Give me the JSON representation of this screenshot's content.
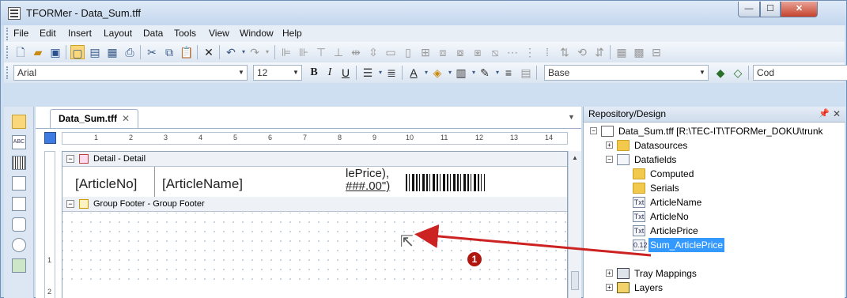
{
  "window": {
    "title": "TFORMer - Data_Sum.tff"
  },
  "menu": [
    "File",
    "Edit",
    "Insert",
    "Layout",
    "Data",
    "Tools",
    "View",
    "Window",
    "Help"
  ],
  "format_toolbar": {
    "font": "Arial",
    "size": "12",
    "style": "Base",
    "code_label": "Cod"
  },
  "document": {
    "tab_label": "Data_Sum.tff",
    "ruler_numbers": [
      "1",
      "2",
      "3",
      "4",
      "5",
      "6",
      "7",
      "8",
      "9",
      "10",
      "11",
      "12",
      "13",
      "14"
    ],
    "vruler_numbers": [
      "1",
      "2"
    ],
    "detail_band": "Detail - Detail",
    "footer_band": "Group Footer - Group Footer",
    "fields": {
      "article_no": "[ArticleNo]",
      "article_name": "[ArticleName]",
      "price_line1": "lePrice),",
      "price_line2": "###.00\")"
    }
  },
  "marker": "1",
  "repository": {
    "title": "Repository/Design",
    "root": "Data_Sum.tff [R:\\TEC-IT\\TFORMer_DOKU\\trunk",
    "datasources": "Datasources",
    "datafields": "Datafields",
    "computed": "Computed",
    "serials": "Serials",
    "article_name": "ArticleName",
    "article_no": "ArticleNo",
    "article_price": "ArticlePrice",
    "sum_article_price": "Sum_ArticlePrice",
    "tray_mappings": "Tray Mappings",
    "layers": "Layers",
    "txt_icon": "Txt",
    "num_icon": "0.12"
  },
  "colors": {
    "accent": "#3399ff",
    "arrow": "#cc2222",
    "marker": "#b0160e"
  }
}
